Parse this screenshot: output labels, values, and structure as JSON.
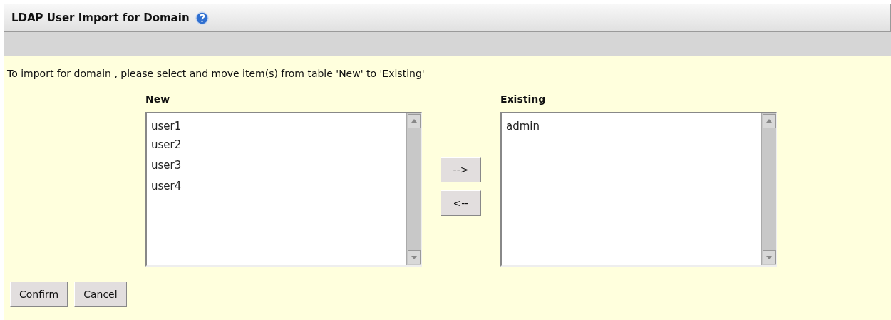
{
  "header": {
    "title": "LDAP User Import for Domain"
  },
  "instruction": "To import for domain , please select and move item(s) from table 'New' to 'Existing'",
  "lists": [
    {
      "label": "New",
      "items": [
        "user1",
        "user2",
        "user3",
        "user4"
      ]
    },
    {
      "label": "Existing",
      "items": [
        "admin"
      ]
    }
  ],
  "move_buttons": [
    "-->",
    "<--"
  ],
  "buttons": [
    "Confirm",
    "Cancel"
  ]
}
